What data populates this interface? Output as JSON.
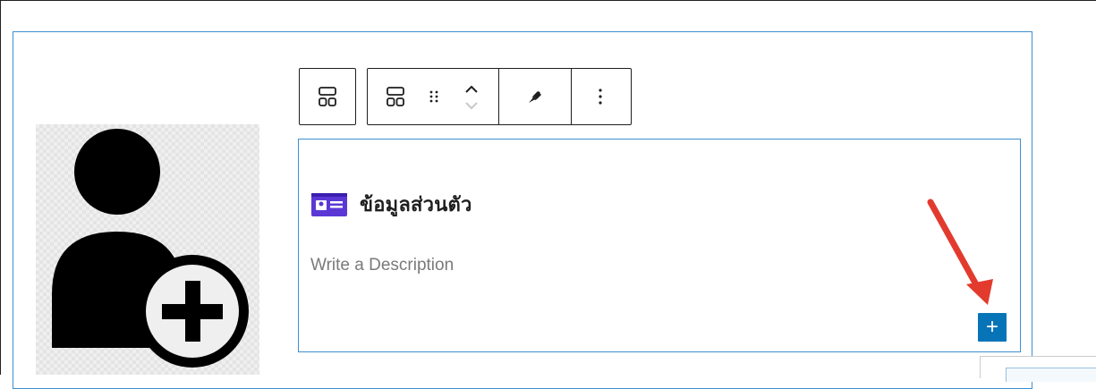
{
  "block": {
    "heading": "ข้อมูลส่วนตัว",
    "description_placeholder": "Write a Description",
    "add_button_symbol": "+"
  },
  "toolbar": {
    "buttons": [
      {
        "name": "block-type",
        "icon": "grid-layout-icon"
      },
      {
        "name": "parent-block",
        "icon": "grid-layout-icon"
      },
      {
        "name": "drag-handle",
        "icon": "drag-handle-icon"
      },
      {
        "name": "move-up",
        "icon": "chevron-up-icon"
      },
      {
        "name": "style",
        "icon": "paintbrush-icon"
      },
      {
        "name": "options",
        "icon": "more-vertical-icon"
      }
    ]
  },
  "avatar": {
    "icon": "add-user-icon"
  },
  "colors": {
    "accent": "#0874b8",
    "block_border": "#3f8fd0",
    "heading_icon": "#5b38d6",
    "annotation_arrow": "#e23b2e"
  }
}
